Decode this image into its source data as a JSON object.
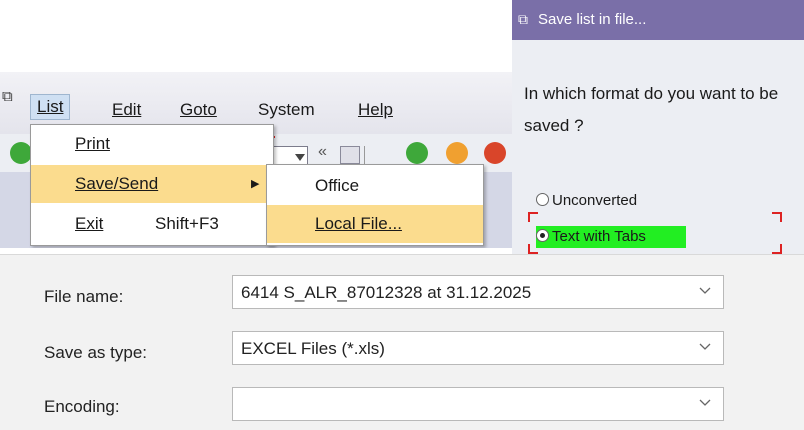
{
  "sap_menu": {
    "menubar": [
      "List",
      "Edit",
      "Goto",
      "System",
      "Help"
    ],
    "dropdown": [
      {
        "label": "Print",
        "shortcut": ""
      },
      {
        "label": "Save/Send",
        "shortcut": "",
        "has_submenu": true
      },
      {
        "label": "Exit",
        "shortcut": "Shift+F3"
      }
    ],
    "submenu": [
      "Office",
      "Local File..."
    ],
    "toolbar_glyph": "«"
  },
  "save_dialog": {
    "title": "Save list in file...",
    "question": "In which format do you want to be saved ?",
    "options": [
      {
        "label": "Unconverted",
        "selected": false
      },
      {
        "label": "Text with Tabs",
        "selected": true
      }
    ],
    "selected_highlight_color": "#22ee22"
  },
  "file_dialog": {
    "file_name": {
      "label": "File name:",
      "value": "6414 S_ALR_87012328 at 31.12.2025"
    },
    "save_as_type": {
      "label": "Save as type:",
      "value": "EXCEL Files (*.xls)"
    },
    "encoding": {
      "label": "Encoding:",
      "value": ""
    }
  },
  "colors": {
    "menu_highlight": "#fbdc8e",
    "dialog_titlebar": "#7a6fa8",
    "check_green": "#3ea83a",
    "cancel_red": "#d9452a",
    "warning_orange": "#f0a030"
  },
  "icons": [
    "sap-window-icon",
    "check-icon",
    "save-icon",
    "back-icon",
    "exit-icon",
    "cancel-icon",
    "chevron-down-icon",
    "submenu-arrow-icon",
    "radio-icon"
  ]
}
